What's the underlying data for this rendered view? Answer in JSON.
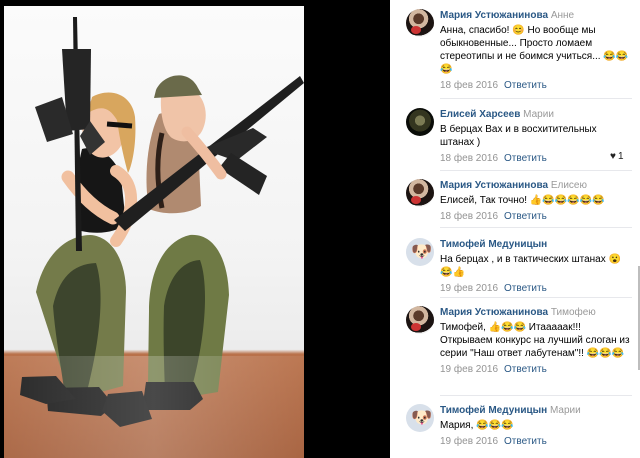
{
  "comments": [
    {
      "author": "Мария Устюжанинова",
      "reply_to": "Анне",
      "text": "Анна, спасибо! 😊 Но вообще мы обыкновенные... Просто ломаем стереотипы и не боимся учиться... 😂😂😂",
      "date": "18 фев 2016",
      "reply_label": "Ответить",
      "likes": ""
    },
    {
      "author": "Елисей Харсеев",
      "reply_to": "Марии",
      "text": "В берцах Вах и в восхитительных штанах )",
      "date": "18 фев 2016",
      "reply_label": "Ответить",
      "likes": "1"
    },
    {
      "author": "Мария Устюжанинова",
      "reply_to": "Елисею",
      "text": "Елисей, Так точно! 👍😂😂😂😂😂",
      "date": "18 фев 2016",
      "reply_label": "Ответить",
      "likes": ""
    },
    {
      "author": "Тимофей Медуницын",
      "reply_to": "",
      "text": "На берцах , и в тактических штанах 😮😂👍",
      "date": "19 фев 2016",
      "reply_label": "Ответить",
      "likes": ""
    },
    {
      "author": "Мария Устюжанинова",
      "reply_to": "Тимофею",
      "text": "Тимофей, 👍😂😂 Итааааак!!! Открываем конкурс на лучший слоган из серии \"Наш ответ лабутенам\"!! 😂😂😂",
      "date": "19 фев 2016",
      "reply_label": "Ответить",
      "likes": ""
    },
    {
      "author": "Тимофей Медуницын",
      "reply_to": "Марии",
      "text": "Мария, 😂😂😂",
      "date": "19 фев 2016",
      "reply_label": "Ответить",
      "likes": ""
    }
  ],
  "icons": {
    "like": "heart-icon",
    "avatar_default": "dog-avatar-icon",
    "emoji": "emoji-icon"
  }
}
